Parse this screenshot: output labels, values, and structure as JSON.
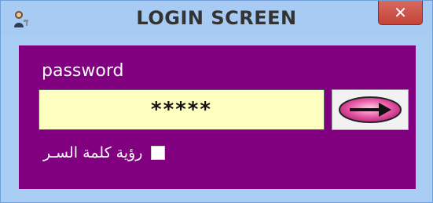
{
  "window": {
    "title": "LOGIN SCREEN",
    "close_symbol": "✕",
    "app_icon": "user-key-icon"
  },
  "form": {
    "password_label": "password",
    "password_value": "*****",
    "submit_icon": "arrow-right-icon",
    "show_password_label": "رؤية كلمة السـر",
    "show_password_checked": false
  },
  "colors": {
    "panel_background": "#800080",
    "input_background": "#ffffc0",
    "titlebar_background": "#a7cbf2",
    "close_button": "#c44338",
    "arrow_button_fill": "#e85aa6"
  }
}
